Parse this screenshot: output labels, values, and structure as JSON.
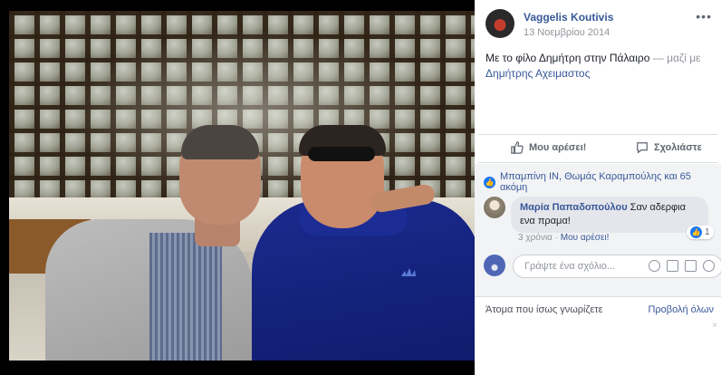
{
  "post": {
    "author": "Vaggelis Koutivis",
    "date": "13 Νοεμβρίου 2014",
    "more": "•••",
    "caption_text": "Με το φίλο Δημήτρη στην Πάλαιρο",
    "caption_with": " — μαζί με",
    "caption_tag": "Δημήτρης Αχειμαστος"
  },
  "actions": {
    "like_label": "Μου αρέσει!",
    "comment_label": "Σχολιάστε"
  },
  "reactions": {
    "summary": "Μπαμπίνη ΙΝ, Θωμάς Καραμπούλης και 65 ακόμη"
  },
  "comment": {
    "name": "Μαρία Παπαδοπούλου",
    "text": " Σαν αδερφια ενα πραμα!",
    "reaction_count": "1",
    "time": "3 χρόνια",
    "sep": " · ",
    "like_link": "Μου αρέσει!"
  },
  "composer": {
    "placeholder": "Γράψτε ένα σχόλιο..."
  },
  "pymk": {
    "title": "Άτομα που ίσως γνωρίζετε",
    "see_all": "Προβολή όλων",
    "close": "×"
  },
  "colors": {
    "link": "#385898",
    "meta": "#90949c",
    "like_blue": "#1877f2"
  },
  "icons": [
    "thumbs-up-icon",
    "comment-icon",
    "like-reaction-icon",
    "emoji-icon",
    "camera-icon",
    "gif-icon",
    "sticker-icon"
  ]
}
